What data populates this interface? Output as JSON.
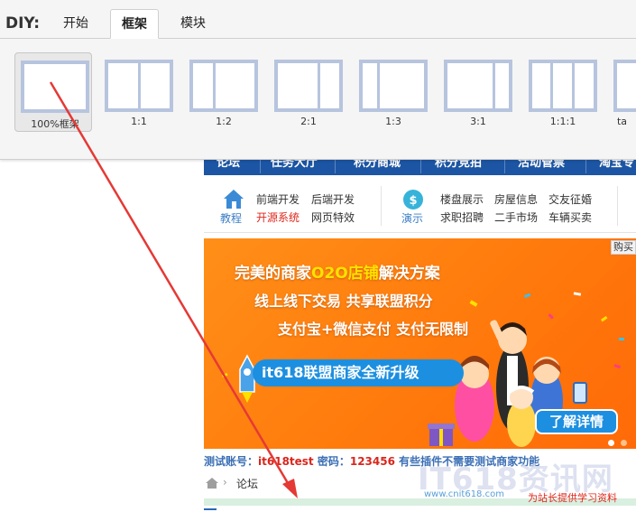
{
  "diy": {
    "label": "DIY:",
    "tabs": [
      {
        "label": "开始",
        "active": false
      },
      {
        "label": "框架",
        "active": true
      },
      {
        "label": "模块",
        "active": false
      }
    ],
    "frames": [
      {
        "label": "100%框架",
        "selected": true
      },
      {
        "label": "1:1"
      },
      {
        "label": "1:2"
      },
      {
        "label": "2:1"
      },
      {
        "label": "1:3"
      },
      {
        "label": "3:1"
      },
      {
        "label": "1:1:1"
      },
      {
        "label": "ta"
      }
    ]
  },
  "forum": {
    "nav": [
      "论坛",
      "任务大厅",
      "积分商城",
      "积分竞拍",
      "活动管票",
      "淘宝专"
    ],
    "subnav": {
      "group1": {
        "icon": "home-icon",
        "label": "教程",
        "links": [
          {
            "text": "前端开发"
          },
          {
            "text": "后端开发"
          },
          {
            "text": "开源系统",
            "hot": true
          },
          {
            "text": "网页特效"
          }
        ]
      },
      "group2": {
        "icon": "coin-icon",
        "label": "演示",
        "links": [
          {
            "text": "楼盘展示"
          },
          {
            "text": "房屋信息"
          },
          {
            "text": "交友征婚"
          },
          {
            "text": "求职招聘"
          },
          {
            "text": "二手市场"
          },
          {
            "text": "车辆买卖"
          }
        ]
      }
    },
    "banner": {
      "buy_tag": "购买",
      "line1_pre": "完美的商家",
      "line1_hi": "O2O店铺",
      "line1_post": "解决方案",
      "line2": "线上线下交易 共享联盟积分",
      "line3": "支付宝+微信支付 支付无限制",
      "badge": "it618联盟商家全新升级",
      "detail_button": "了解详情"
    },
    "info": {
      "account_label": "测试账号：",
      "account_value": "it618test",
      "password_label": " 密码：",
      "password_value": "123456",
      "rest": " 有些插件不需要测试商家功能"
    },
    "breadcrumb": "论坛"
  },
  "watermark": {
    "logo": "IT618资讯网",
    "url": "www.cnit618.com",
    "tagline": "为站长提供学习资料"
  },
  "colors": {
    "nav_blue": "#1c55a3",
    "banner_orange": "#ff7a0c",
    "badge_blue": "#1d8fe0",
    "frame_border": "#b7c4de",
    "arrow_red": "#e53935",
    "hot_red": "#e0261b"
  }
}
